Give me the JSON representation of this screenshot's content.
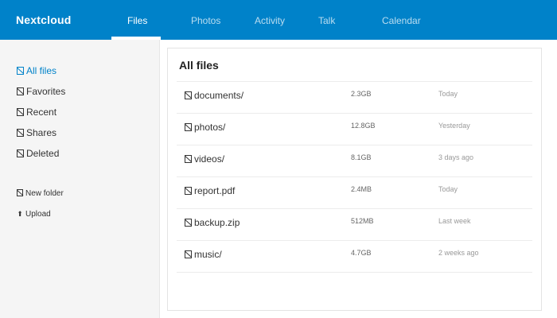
{
  "app": {
    "brand": "Nextcloud",
    "accent_color": "#0082c9"
  },
  "nav": {
    "items": [
      {
        "label": "Files",
        "active": true
      },
      {
        "label": "Photos",
        "active": false
      },
      {
        "label": "Activity",
        "active": false
      },
      {
        "label": "Talk",
        "active": false
      },
      {
        "label": "Calendar",
        "active": false
      }
    ]
  },
  "sidebar": {
    "items": [
      {
        "label": "All files",
        "icon": "folder-icon",
        "active": true
      },
      {
        "label": "Favorites",
        "icon": "star-icon",
        "active": false
      },
      {
        "label": "Recent",
        "icon": "clock-icon",
        "active": false
      },
      {
        "label": "Shares",
        "icon": "share-icon",
        "active": false
      },
      {
        "label": "Deleted",
        "icon": "trash-icon",
        "active": false
      }
    ],
    "actions": [
      {
        "label": "New folder",
        "icon": "new-folder-icon"
      },
      {
        "label": "Upload",
        "icon": "upload-arrow-icon",
        "glyph": "⬆"
      }
    ]
  },
  "main": {
    "title": "All files",
    "files": [
      {
        "name": "documents/",
        "size": "2.3GB",
        "modified": "Today",
        "icon": "folder-icon"
      },
      {
        "name": "photos/",
        "size": "12.8GB",
        "modified": "Yesterday",
        "icon": "folder-icon"
      },
      {
        "name": "videos/",
        "size": "8.1GB",
        "modified": "3 days ago",
        "icon": "folder-icon"
      },
      {
        "name": "report.pdf",
        "size": "2.4MB",
        "modified": "Today",
        "icon": "file-icon"
      },
      {
        "name": "backup.zip",
        "size": "512MB",
        "modified": "Last week",
        "icon": "file-icon"
      },
      {
        "name": "music/",
        "size": "4.7GB",
        "modified": "2 weeks ago",
        "icon": "folder-icon"
      }
    ]
  }
}
